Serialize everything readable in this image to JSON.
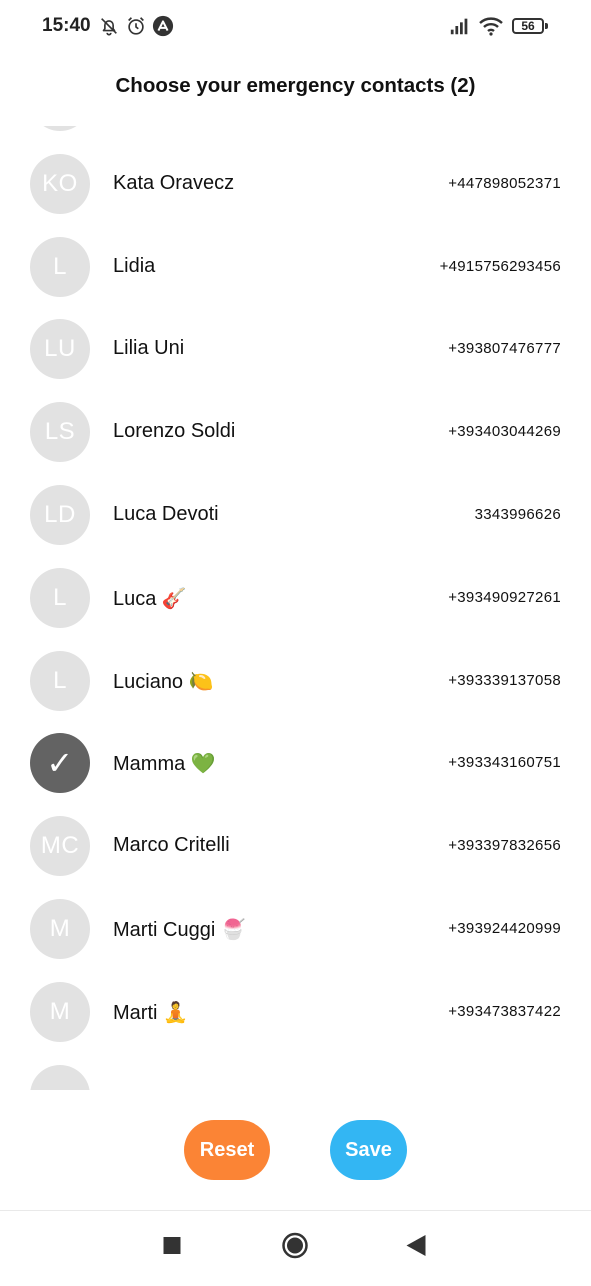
{
  "status_bar": {
    "time": "15:40",
    "battery": "56",
    "icons": [
      "bell-off-icon",
      "alarm-icon",
      "app-notification-icon",
      "signal-icon",
      "wifi-icon",
      "battery-icon"
    ]
  },
  "page": {
    "title": "Choose your emergency contacts (2)"
  },
  "contacts": [
    {
      "initials": "",
      "name": "",
      "phone": "",
      "selected": false
    },
    {
      "initials": "KO",
      "name": "Kata Oravecz",
      "phone": "+447898052371",
      "selected": false
    },
    {
      "initials": "L",
      "name": "Lidia",
      "phone": "+4915756293456",
      "selected": false
    },
    {
      "initials": "LU",
      "name": "Lilia Uni",
      "phone": "+393807476777",
      "selected": false
    },
    {
      "initials": "LS",
      "name": "Lorenzo Soldi",
      "phone": "+393403044269",
      "selected": false
    },
    {
      "initials": "LD",
      "name": "Luca Devoti",
      "phone": "3343996626",
      "selected": false
    },
    {
      "initials": "L",
      "name": "Luca 🎸",
      "phone": "+393490927261",
      "selected": false
    },
    {
      "initials": "L",
      "name": "Luciano 🍋",
      "phone": "+393339137058",
      "selected": false
    },
    {
      "initials": "✓",
      "name": "Mamma 💚",
      "phone": "+393343160751",
      "selected": true
    },
    {
      "initials": "MC",
      "name": "Marco Critelli",
      "phone": "+393397832656",
      "selected": false
    },
    {
      "initials": "M",
      "name": "Marti Cuggi 🍧",
      "phone": "+393924420999",
      "selected": false
    },
    {
      "initials": "M",
      "name": "Marti 🧘",
      "phone": "+393473837422",
      "selected": false
    },
    {
      "initials": "",
      "name": "",
      "phone": "",
      "selected": false
    }
  ],
  "actions": {
    "reset_label": "Reset",
    "save_label": "Save"
  },
  "nav": {
    "icons": [
      "recents-square-icon",
      "home-circle-icon",
      "back-triangle-icon"
    ]
  },
  "colors": {
    "reset": "#fb8435",
    "save": "#33b6f3",
    "avatar": "#e2e2e2",
    "avatar_selected": "#636363"
  }
}
